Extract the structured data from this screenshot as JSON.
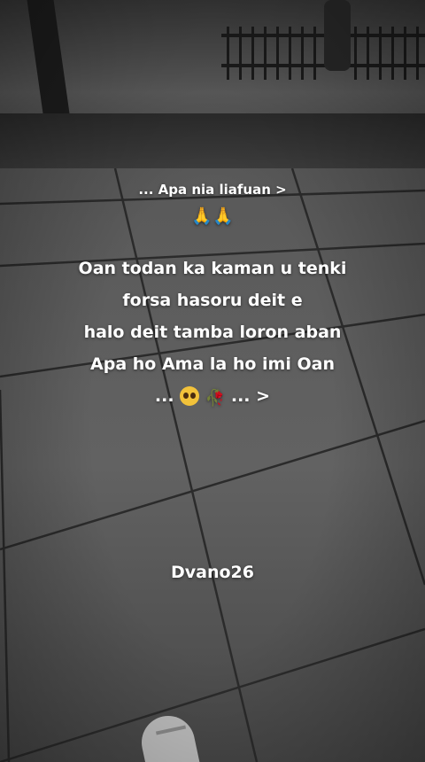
{
  "caption": {
    "header": "... Apa nia liafuan >",
    "pray_emoji": "🙏🙏",
    "lines": [
      "Oan todan ka kaman u tenki",
      "forsa hasoru deit e",
      "halo deit tamba loron aban",
      "Apa ho Ama la ho imi Oan"
    ],
    "last_line_prefix": "...",
    "last_line_emoji_1": "pleading-face",
    "last_line_emoji_2": "🥀",
    "last_line_suffix": "... >"
  },
  "signature": "Dvano26",
  "colors": {
    "text": "#ffffff",
    "floor": "#5a5a5a"
  }
}
